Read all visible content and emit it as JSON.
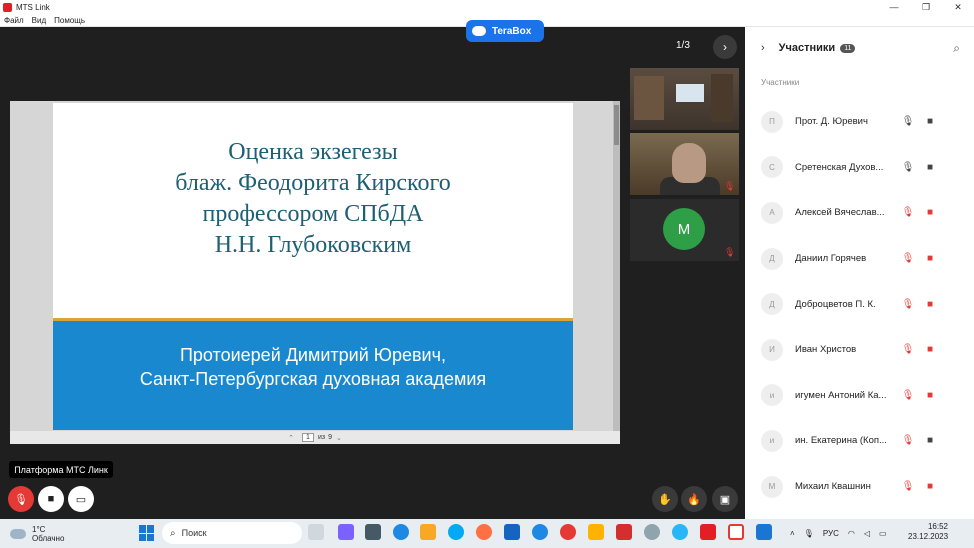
{
  "window": {
    "title": "MTS Link",
    "controls": {
      "minimize": "—",
      "maximize": "❐",
      "close": "✕"
    },
    "menu": [
      "Файл",
      "Вид",
      "Помощь"
    ]
  },
  "terabox": {
    "label": "TeraBox"
  },
  "slides": {
    "pager": "1/3"
  },
  "slide": {
    "title_lines": [
      "Оценка экзегезы",
      "блаж. Феодорита Кирского",
      "профессором СПбДА",
      "Н.Н. Глубоковским"
    ],
    "subtitle_lines": [
      "Протоиерей Димитрий Юревич,",
      "Санкт-Петербургская духовная академия"
    ],
    "nav": {
      "page": "1",
      "of_label": "из",
      "total": "9"
    }
  },
  "video_tiles": {
    "avatar_letter": "M"
  },
  "platform_tip": "Платформа МТС Линк",
  "participants": {
    "title": "Участники",
    "count": "11",
    "section_label": "Участники",
    "items": [
      {
        "initial": "П",
        "name": "Прот. Д. Юревич",
        "mic": "on",
        "cam": "on"
      },
      {
        "initial": "С",
        "name": "Сретенская Духов...",
        "mic": "on",
        "cam": "on"
      },
      {
        "initial": "А",
        "name": "Алексей Вячеслав...",
        "mic": "off",
        "cam": "off"
      },
      {
        "initial": "Д",
        "name": "Даниил Горячев",
        "mic": "off",
        "cam": "off"
      },
      {
        "initial": "Д",
        "name": "Доброцветов П. К.",
        "mic": "off",
        "cam": "off"
      },
      {
        "initial": "И",
        "name": "Иван Христов",
        "mic": "off",
        "cam": "off"
      },
      {
        "initial": "и",
        "name": "игумен Антоний Ка...",
        "mic": "off",
        "cam": "off"
      },
      {
        "initial": "и",
        "name": "ин. Екатерина (Коп...",
        "mic": "off",
        "cam": "on"
      },
      {
        "initial": "М",
        "name": "Михаил Квашнин",
        "mic": "off",
        "cam": "off"
      }
    ]
  },
  "taskbar": {
    "weather_temp": "1°C",
    "weather_desc": "Облачно",
    "search_placeholder": "Поиск",
    "lang": "РУС",
    "time": "16:52",
    "date": "23.12.2023"
  },
  "colors": {
    "slide_title": "#1e5f74",
    "slide_band": "#1a88cf",
    "gold_rule": "#d9a43a",
    "mic_off": "#e53935",
    "avatar_green": "#2e9e47"
  }
}
